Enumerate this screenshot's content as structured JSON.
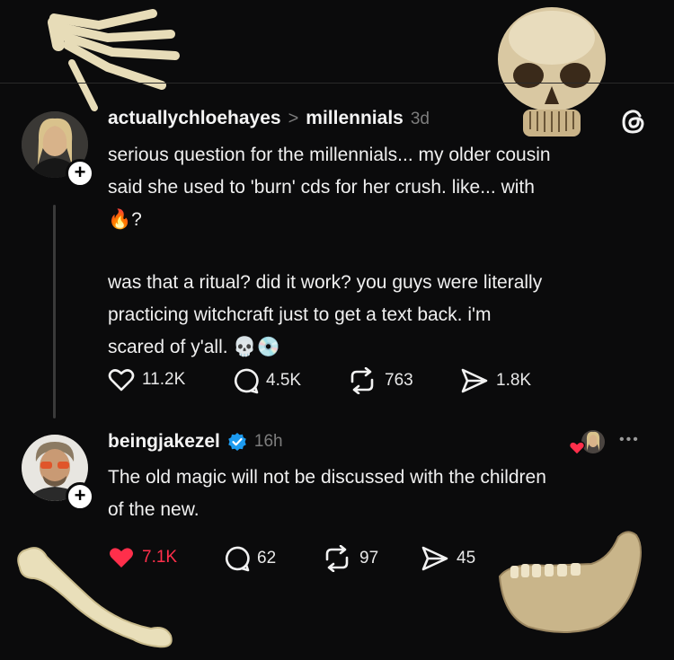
{
  "post1": {
    "username": "actuallychloehayes",
    "separator": ">",
    "community": "millennials",
    "age": "3d",
    "text_line1": "serious question for the millennials... my older cousin",
    "text_line2": "said she used to 'burn' cds for her crush. like... with",
    "text_line3": "🔥?",
    "text_line4": "was that a ritual? did it work? you guys were literally",
    "text_line5": "practicing witchcraft just to get a text back. i'm",
    "text_line6": "scared of y'all. 💀💿",
    "likes": "11.2K",
    "comments": "4.5K",
    "reposts": "763",
    "shares": "1.8K"
  },
  "post2": {
    "username": "beingjakezel",
    "age": "16h",
    "text_line1": "The old magic will not be discussed with the children",
    "text_line2": "of the new.",
    "likes": "7.1K",
    "comments": "62",
    "reposts": "97",
    "shares": "45",
    "more": "•••"
  },
  "colors": {
    "background": "#0b0b0c",
    "liked": "#ff2f4b",
    "verified": "#1d9bf0",
    "muted": "#7d7d7d"
  }
}
